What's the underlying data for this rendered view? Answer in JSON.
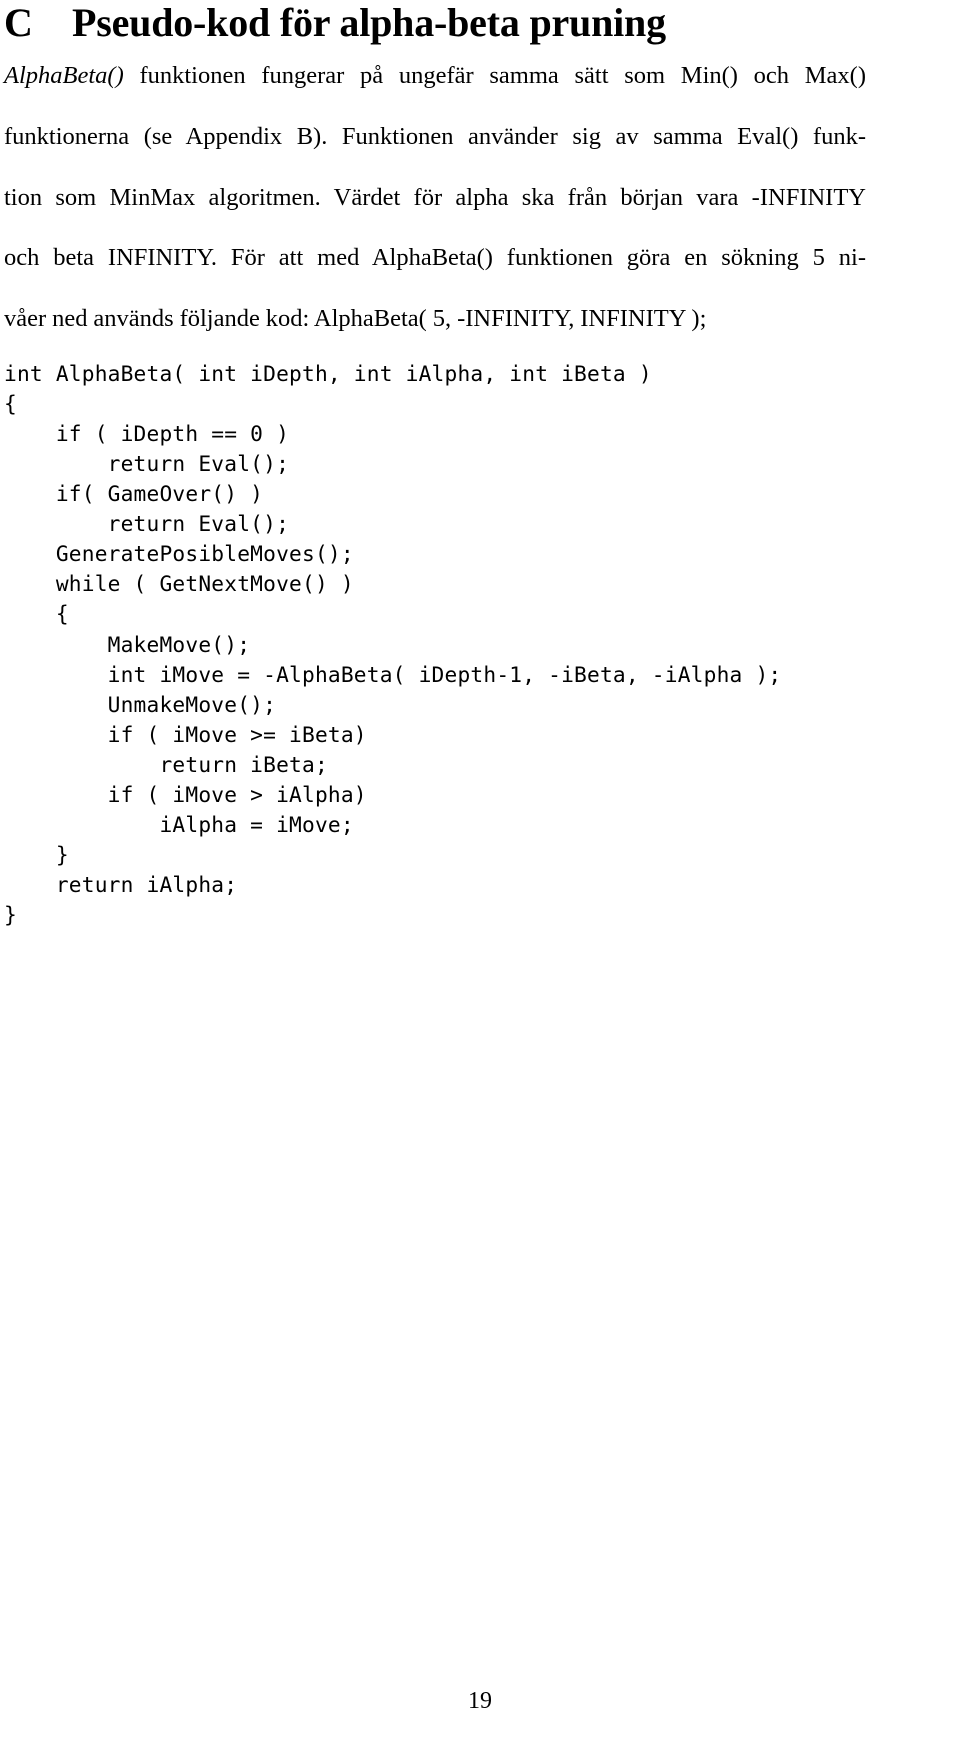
{
  "document": {
    "page_number": "19",
    "language": "sv"
  },
  "heading": {
    "label": "C",
    "title": "Pseudo-kod för alpha-beta pruning"
  },
  "paragraph": {
    "full_text": "AlphaBeta() funktionen fungerar på ungefär samma sätt som Min() och Max() funktionerna (se Appendix B). Funktionen använder sig av samma Eval() funktion som MinMax algoritmen. Värdet för alpha ska från början vara -INFINITY och beta INFINITY. För att med AlphaBeta() funktionen göra en sökning 5 nivåer ned används följande kod: AlphaBeta( 5, -INFINITY, INFINITY );",
    "italic_lead": "AlphaBeta()",
    "lines": [
      " funktionen fungerar på ungefär samma sätt som Min() och Max()",
      "funktionerna (se Appendix B). Funktionen använder sig av samma Eval() funk-",
      "tion som MinMax algoritmen. Värdet för alpha ska från början vara -INFINITY",
      "och beta INFINITY. För att med AlphaBeta() funktionen göra en sökning 5 ni-",
      "våer ned används följande kod: AlphaBeta( 5, -INFINITY, INFINITY );"
    ]
  },
  "code_listing": {
    "language": "c",
    "lines": [
      "int AlphaBeta( int iDepth, int iAlpha, int iBeta )",
      "{",
      "    if ( iDepth == 0 )",
      "        return Eval();",
      "    if( GameOver() )",
      "        return Eval();",
      "    GeneratePosibleMoves();",
      "    while ( GetNextMove() )",
      "    {",
      "        MakeMove();",
      "        int iMove = -AlphaBeta( iDepth-1, -iBeta, -iAlpha );",
      "        UnmakeMove();",
      "        if ( iMove >= iBeta)",
      "            return iBeta;",
      "        if ( iMove > iAlpha)",
      "            iAlpha = iMove;",
      "    }",
      "    return iAlpha;",
      "}"
    ]
  }
}
